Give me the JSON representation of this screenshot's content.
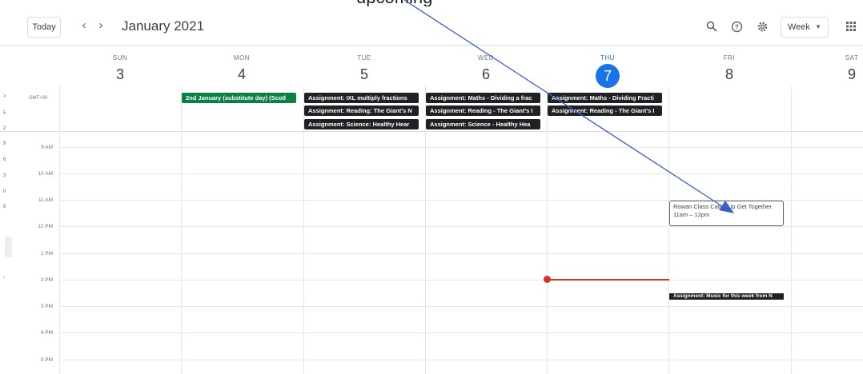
{
  "toolbar": {
    "today_label": "Today",
    "prev_icon": "‹",
    "next_icon": "›",
    "month_label": "January 2021",
    "view_label": "Week"
  },
  "top_partial_text": "upcoming",
  "timezone": "GMT+00",
  "days": [
    {
      "name": "SUN",
      "num": "3"
    },
    {
      "name": "MON",
      "num": "4"
    },
    {
      "name": "TUE",
      "num": "5"
    },
    {
      "name": "WED",
      "num": "6"
    },
    {
      "name": "THU",
      "num": "7"
    },
    {
      "name": "FRI",
      "num": "8"
    },
    {
      "name": "SAT",
      "num": "9"
    }
  ],
  "hours": [
    "9 AM",
    "10 AM",
    "11 AM",
    "12 PM",
    "1 PM",
    "2 PM",
    "3 PM",
    "4 PM",
    "5 PM"
  ],
  "allday_events": {
    "mon": "2nd January (substitute day) (Scotl",
    "tue_1": "Assignment: IXL multiply fractions",
    "tue_2": "Assignment: Reading: The Giant's N",
    "tue_3": "Assignment: Science: Healthy Hear",
    "wed_1": "Assignment: Maths - Dividing a frac",
    "wed_2": "Assignment: Reading - The Giant's I",
    "wed_3": "Assignment: Science - Healthy Hea",
    "thu_1": "Assignment: Maths - Dividing Fracti",
    "thu_2": "Assignment: Reading - The Giant's I"
  },
  "timed_events": {
    "rowan_title": "Rowan Class Catch Up Get Together",
    "rowan_time": "11am – 12pm",
    "music": "Assignment: Music for this week from N"
  },
  "left_fragments": [
    ">",
    "5",
    "2",
    "9",
    "6",
    "3",
    "0",
    "6",
    "›"
  ],
  "colors": {
    "accent": "#1a73e8",
    "event_dark": "#202124",
    "holiday_green": "#0b8043",
    "now_line": "#d93025",
    "annotation_arrow": "#3a5fc8"
  }
}
